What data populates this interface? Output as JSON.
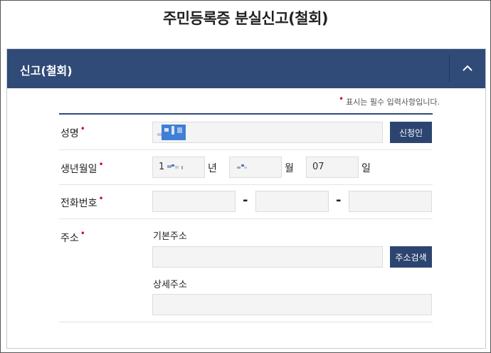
{
  "page_title": "주민등록증 분실신고(철회)",
  "panel": {
    "title": "신고(철회)"
  },
  "required_note": "표시는 필수 입력사항입니다.",
  "fields": {
    "name": {
      "label": "성명",
      "value": "",
      "button": "신청인"
    },
    "birth": {
      "label": "생년월일",
      "year_value": "1",
      "year_unit": "년",
      "month_value": "",
      "month_unit": "월",
      "day_value": "07",
      "day_unit": "일"
    },
    "phone": {
      "label": "전화번호",
      "separator": "-",
      "part1": "",
      "part2": "",
      "part3": ""
    },
    "address": {
      "label": "주소",
      "basic_label": "기본주소",
      "basic_value": "",
      "search_button": "주소검색",
      "detail_label": "상세주소",
      "detail_value": ""
    }
  },
  "colors": {
    "header_bg": "#314b78",
    "button_bg": "#2c4570",
    "required": "#d4001e"
  }
}
